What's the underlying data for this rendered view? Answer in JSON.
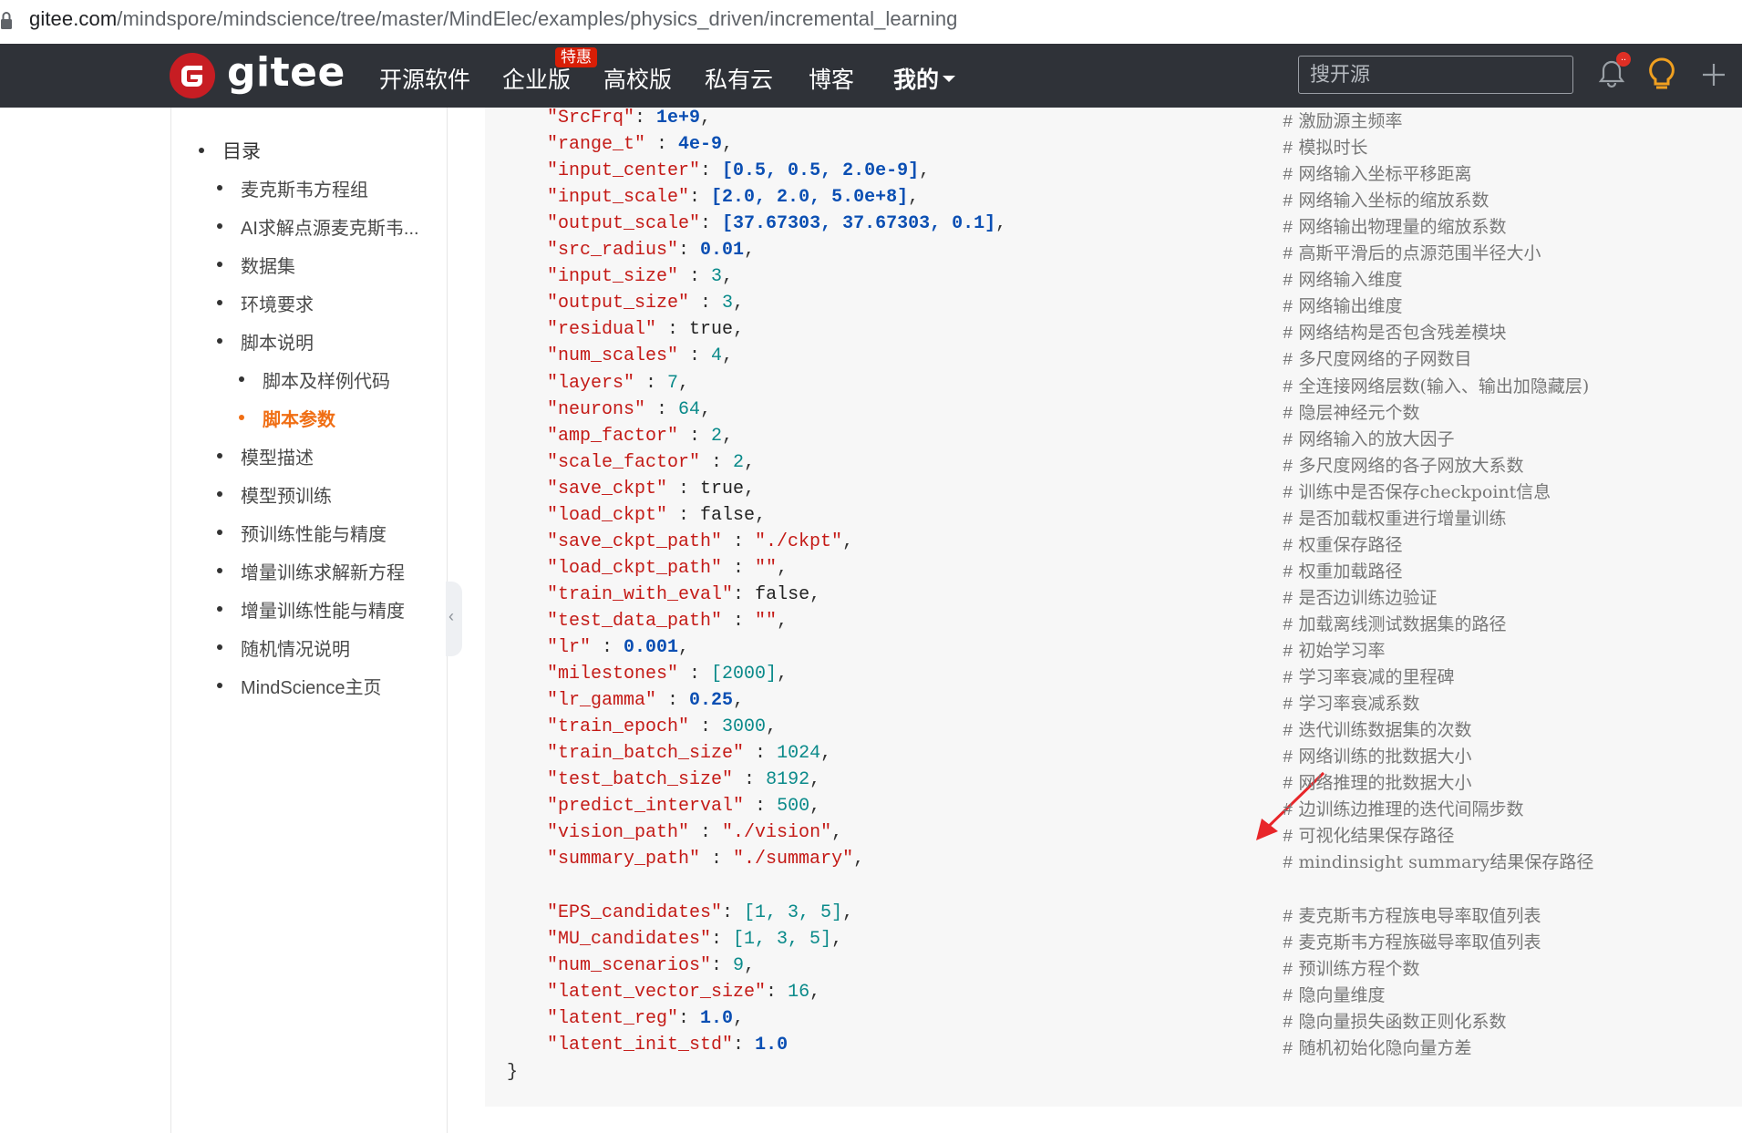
{
  "address_bar": {
    "host": "gitee.com",
    "path": "/mindspore/mindscience/tree/master/MindElec/examples/physics_driven/incremental_learning"
  },
  "header": {
    "logo_text": "gitee",
    "nav": [
      "开源软件",
      "企业版",
      "高校版",
      "私有云",
      "博客",
      "我的"
    ],
    "enterprise_badge": "特惠",
    "search_placeholder": "搜开源",
    "notification_count": "..",
    "colors": {
      "bar": "#2f3238",
      "logo": "#c71d23",
      "badge": "#d81e06",
      "accent": "#f0a020"
    }
  },
  "toc": {
    "title": "目录",
    "items": [
      "麦克斯韦方程组",
      "AI求解点源麦克斯韦...",
      "数据集",
      "环境要求",
      "脚本说明",
      "脚本及样例代码",
      "脚本参数",
      "模型描述",
      "模型预训练",
      "预训练性能与精度",
      "增量训练求解新方程",
      "增量训练性能与精度",
      "随机情况说明",
      "MindScience主页"
    ],
    "active": "脚本参数",
    "active_color": "#f06e14"
  },
  "code": {
    "lines": [
      {
        "key": "\"SrcFrq\"",
        "sep": ": ",
        "value": "1e+9",
        "type": "n",
        "end": ",",
        "comment": "激励源主频率"
      },
      {
        "key": "\"range_t\"",
        "sep": " : ",
        "value": "4e-9",
        "type": "n",
        "end": ",",
        "comment": "模拟时长"
      },
      {
        "key": "\"input_center\"",
        "sep": ": ",
        "value": "[0.5, 0.5, 2.0e-9]",
        "type": "n",
        "end": ",",
        "comment": "网络输入坐标平移距离"
      },
      {
        "key": "\"input_scale\"",
        "sep": ": ",
        "value": "[2.0, 2.0, 5.0e+8]",
        "type": "n",
        "end": ",",
        "comment": "网络输入坐标的缩放系数"
      },
      {
        "key": "\"output_scale\"",
        "sep": ": ",
        "value": "[37.67303, 37.67303, 0.1]",
        "type": "n",
        "end": ",",
        "comment": "网络输出物理量的缩放系数"
      },
      {
        "key": "\"src_radius\"",
        "sep": ": ",
        "value": "0.01",
        "type": "n",
        "end": ",",
        "comment": "高斯平滑后的点源范围半径大小"
      },
      {
        "key": "\"input_size\"",
        "sep": " : ",
        "value": "3",
        "type": "i",
        "end": ",",
        "comment": "网络输入维度"
      },
      {
        "key": "\"output_size\"",
        "sep": " : ",
        "value": "3",
        "type": "i",
        "end": ",",
        "comment": "网络输出维度"
      },
      {
        "key": "\"residual\"",
        "sep": " : ",
        "value": "true",
        "type": "b",
        "end": ",",
        "comment": "网络结构是否包含残差模块"
      },
      {
        "key": "\"num_scales\"",
        "sep": " : ",
        "value": "4",
        "type": "i",
        "end": ",",
        "comment": "多尺度网络的子网数目"
      },
      {
        "key": "\"layers\"",
        "sep": " : ",
        "value": "7",
        "type": "i",
        "end": ",",
        "comment": "全连接网络层数(输入、输出加隐藏层)"
      },
      {
        "key": "\"neurons\"",
        "sep": " : ",
        "value": "64",
        "type": "i",
        "end": ",",
        "comment": "隐层神经元个数"
      },
      {
        "key": "\"amp_factor\"",
        "sep": " : ",
        "value": "2",
        "type": "i",
        "end": ",",
        "comment": "网络输入的放大因子"
      },
      {
        "key": "\"scale_factor\"",
        "sep": " : ",
        "value": "2",
        "type": "i",
        "end": ",",
        "comment": "多尺度网络的各子网放大系数"
      },
      {
        "key": "\"save_ckpt\"",
        "sep": " : ",
        "value": "true",
        "type": "b",
        "end": ",",
        "comment": "训练中是否保存checkpoint信息"
      },
      {
        "key": "\"load_ckpt\"",
        "sep": " : ",
        "value": "false",
        "type": "b",
        "end": ",",
        "comment": "是否加载权重进行增量训练"
      },
      {
        "key": "\"save_ckpt_path\"",
        "sep": " : ",
        "value": "\"./ckpt\"",
        "type": "s",
        "end": ",",
        "comment": "权重保存路径"
      },
      {
        "key": "\"load_ckpt_path\"",
        "sep": " : ",
        "value": "\"\"",
        "type": "s",
        "end": ",",
        "comment": "权重加载路径"
      },
      {
        "key": "\"train_with_eval\"",
        "sep": ": ",
        "value": "false",
        "type": "b",
        "end": ",",
        "comment": "是否边训练边验证"
      },
      {
        "key": "\"test_data_path\"",
        "sep": " : ",
        "value": "\"\"",
        "type": "s",
        "end": ",",
        "comment": "加载离线测试数据集的路径"
      },
      {
        "key": "\"lr\"",
        "sep": " : ",
        "value": "0.001",
        "type": "n",
        "end": ",",
        "comment": "初始学习率"
      },
      {
        "key": "\"milestones\"",
        "sep": " : ",
        "value": "[2000]",
        "type": "i",
        "end": ",",
        "comment": "学习率衰减的里程碑"
      },
      {
        "key": "\"lr_gamma\"",
        "sep": " : ",
        "value": "0.25",
        "type": "n",
        "end": ",",
        "comment": "学习率衰减系数"
      },
      {
        "key": "\"train_epoch\"",
        "sep": " : ",
        "value": "3000",
        "type": "i",
        "end": ",",
        "comment": "迭代训练数据集的次数"
      },
      {
        "key": "\"train_batch_size\"",
        "sep": " : ",
        "value": "1024",
        "type": "i",
        "end": ",",
        "comment": "网络训练的批数据大小"
      },
      {
        "key": "\"test_batch_size\"",
        "sep": " : ",
        "value": "8192",
        "type": "i",
        "end": ",",
        "comment": "网络推理的批数据大小"
      },
      {
        "key": "\"predict_interval\"",
        "sep": " : ",
        "value": "500",
        "type": "i",
        "end": ",",
        "comment": "边训练边推理的迭代间隔步数"
      },
      {
        "key": "\"vision_path\"",
        "sep": " : ",
        "value": "\"./vision\"",
        "type": "s",
        "end": ",",
        "comment": "可视化结果保存路径"
      },
      {
        "key": "\"summary_path\"",
        "sep": " : ",
        "value": "\"./summary\"",
        "type": "s",
        "end": ",",
        "comment": "mindinsight summary结果保存路径"
      },
      {
        "key": "",
        "sep": "",
        "value": "",
        "type": "p",
        "end": "",
        "comment": ""
      },
      {
        "key": "\"EPS_candidates\"",
        "sep": ": ",
        "value": "[1, 3, 5]",
        "type": "i",
        "end": ",",
        "comment": "麦克斯韦方程族电导率取值列表"
      },
      {
        "key": "\"MU_candidates\"",
        "sep": ": ",
        "value": "[1, 3, 5]",
        "type": "i",
        "end": ",",
        "comment": "麦克斯韦方程族磁导率取值列表"
      },
      {
        "key": "\"num_scenarios\"",
        "sep": ": ",
        "value": "9",
        "type": "i",
        "end": ",",
        "comment": "预训练方程个数"
      },
      {
        "key": "\"latent_vector_size\"",
        "sep": ": ",
        "value": "16",
        "type": "i",
        "end": ",",
        "comment": "隐向量维度"
      },
      {
        "key": "\"latent_reg\"",
        "sep": ": ",
        "value": "1.0",
        "type": "n",
        "end": ",",
        "comment": "隐向量损失函数正则化系数"
      },
      {
        "key": "\"latent_init_std\"",
        "sep": ": ",
        "value": "1.0",
        "type": "n",
        "end": "",
        "comment": "随机初始化隐向量方差"
      }
    ],
    "closing": "}",
    "comment_marker": "#"
  }
}
